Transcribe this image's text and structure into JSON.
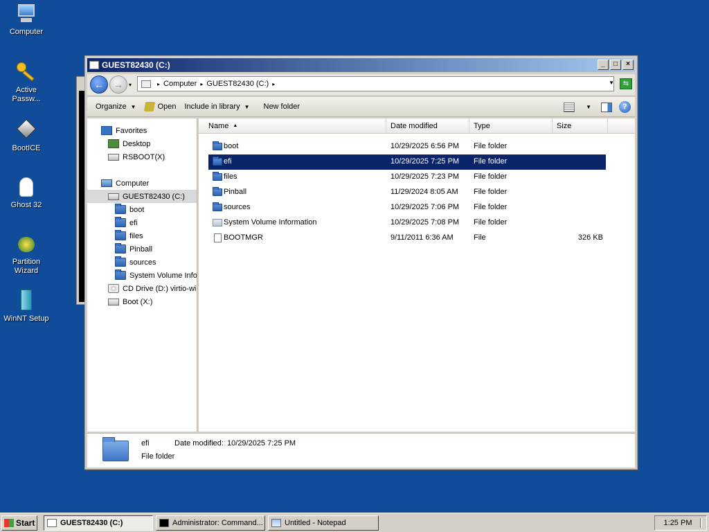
{
  "desktop": {
    "icons": [
      {
        "label": "Computer",
        "icon": "computer-icon"
      },
      {
        "label": "Active\nPassw...",
        "icon": "key-icon"
      },
      {
        "label": "BootICE",
        "icon": "bootice-icon"
      },
      {
        "label": "Ghost 32",
        "icon": "ghost-icon"
      },
      {
        "label": "Partition\nWizard",
        "icon": "partition-wizard-icon"
      },
      {
        "label": "WinNT Setup",
        "icon": "winnt-setup-icon"
      }
    ]
  },
  "window": {
    "title": "GUEST82430 (C:)",
    "buttons": {
      "minimize": "_",
      "maximize": "□",
      "close": "×"
    }
  },
  "address": {
    "crumbs": [
      "Computer",
      "GUEST82430 (C:)"
    ]
  },
  "toolbar": {
    "organize": "Organize",
    "open": "Open",
    "include": "Include in library",
    "new_folder": "New folder"
  },
  "nav": {
    "favorites": "Favorites",
    "desktop": "Desktop",
    "rsboot": "RSBOOT(X)",
    "computer": "Computer",
    "c_drive": "GUEST82430 (C:)",
    "folders": [
      "boot",
      "efi",
      "files",
      "Pinball",
      "sources",
      "System Volume Information"
    ],
    "cd_drive": "CD Drive (D:) virtio-win",
    "boot_drive": "Boot (X:)"
  },
  "columns": {
    "name": "Name",
    "date": "Date modified",
    "type": "Type",
    "size": "Size"
  },
  "files": [
    {
      "name": "boot",
      "date": "10/29/2025 6:56 PM",
      "type": "File folder",
      "size": ""
    },
    {
      "name": "efi",
      "date": "10/29/2025 7:25 PM",
      "type": "File folder",
      "size": ""
    },
    {
      "name": "files",
      "date": "10/29/2025 7:23 PM",
      "type": "File folder",
      "size": ""
    },
    {
      "name": "Pinball",
      "date": "11/29/2024 8:05 AM",
      "type": "File folder",
      "size": ""
    },
    {
      "name": "sources",
      "date": "10/29/2025 7:06 PM",
      "type": "File folder",
      "size": ""
    },
    {
      "name": "System Volume Information",
      "date": "10/29/2025 7:08 PM",
      "type": "File folder",
      "size": ""
    },
    {
      "name": "BOOTMGR",
      "date": "9/11/2011 6:36 AM",
      "type": "File",
      "size": "326 KB"
    }
  ],
  "details": {
    "name": "efi",
    "date_label": "Date modified:",
    "date_value": "10/29/2025 7:25 PM",
    "type": "File folder"
  },
  "taskbar": {
    "start": "Start",
    "tasks": [
      "GUEST82430 (C:)",
      "Administrator: Command...",
      "Untitled - Notepad"
    ],
    "clock": "1:25 PM"
  },
  "colors": {
    "desktop": "#104c9a",
    "selection": "#0a246a",
    "title_start": "#0a246a",
    "title_end": "#a6caf0"
  }
}
